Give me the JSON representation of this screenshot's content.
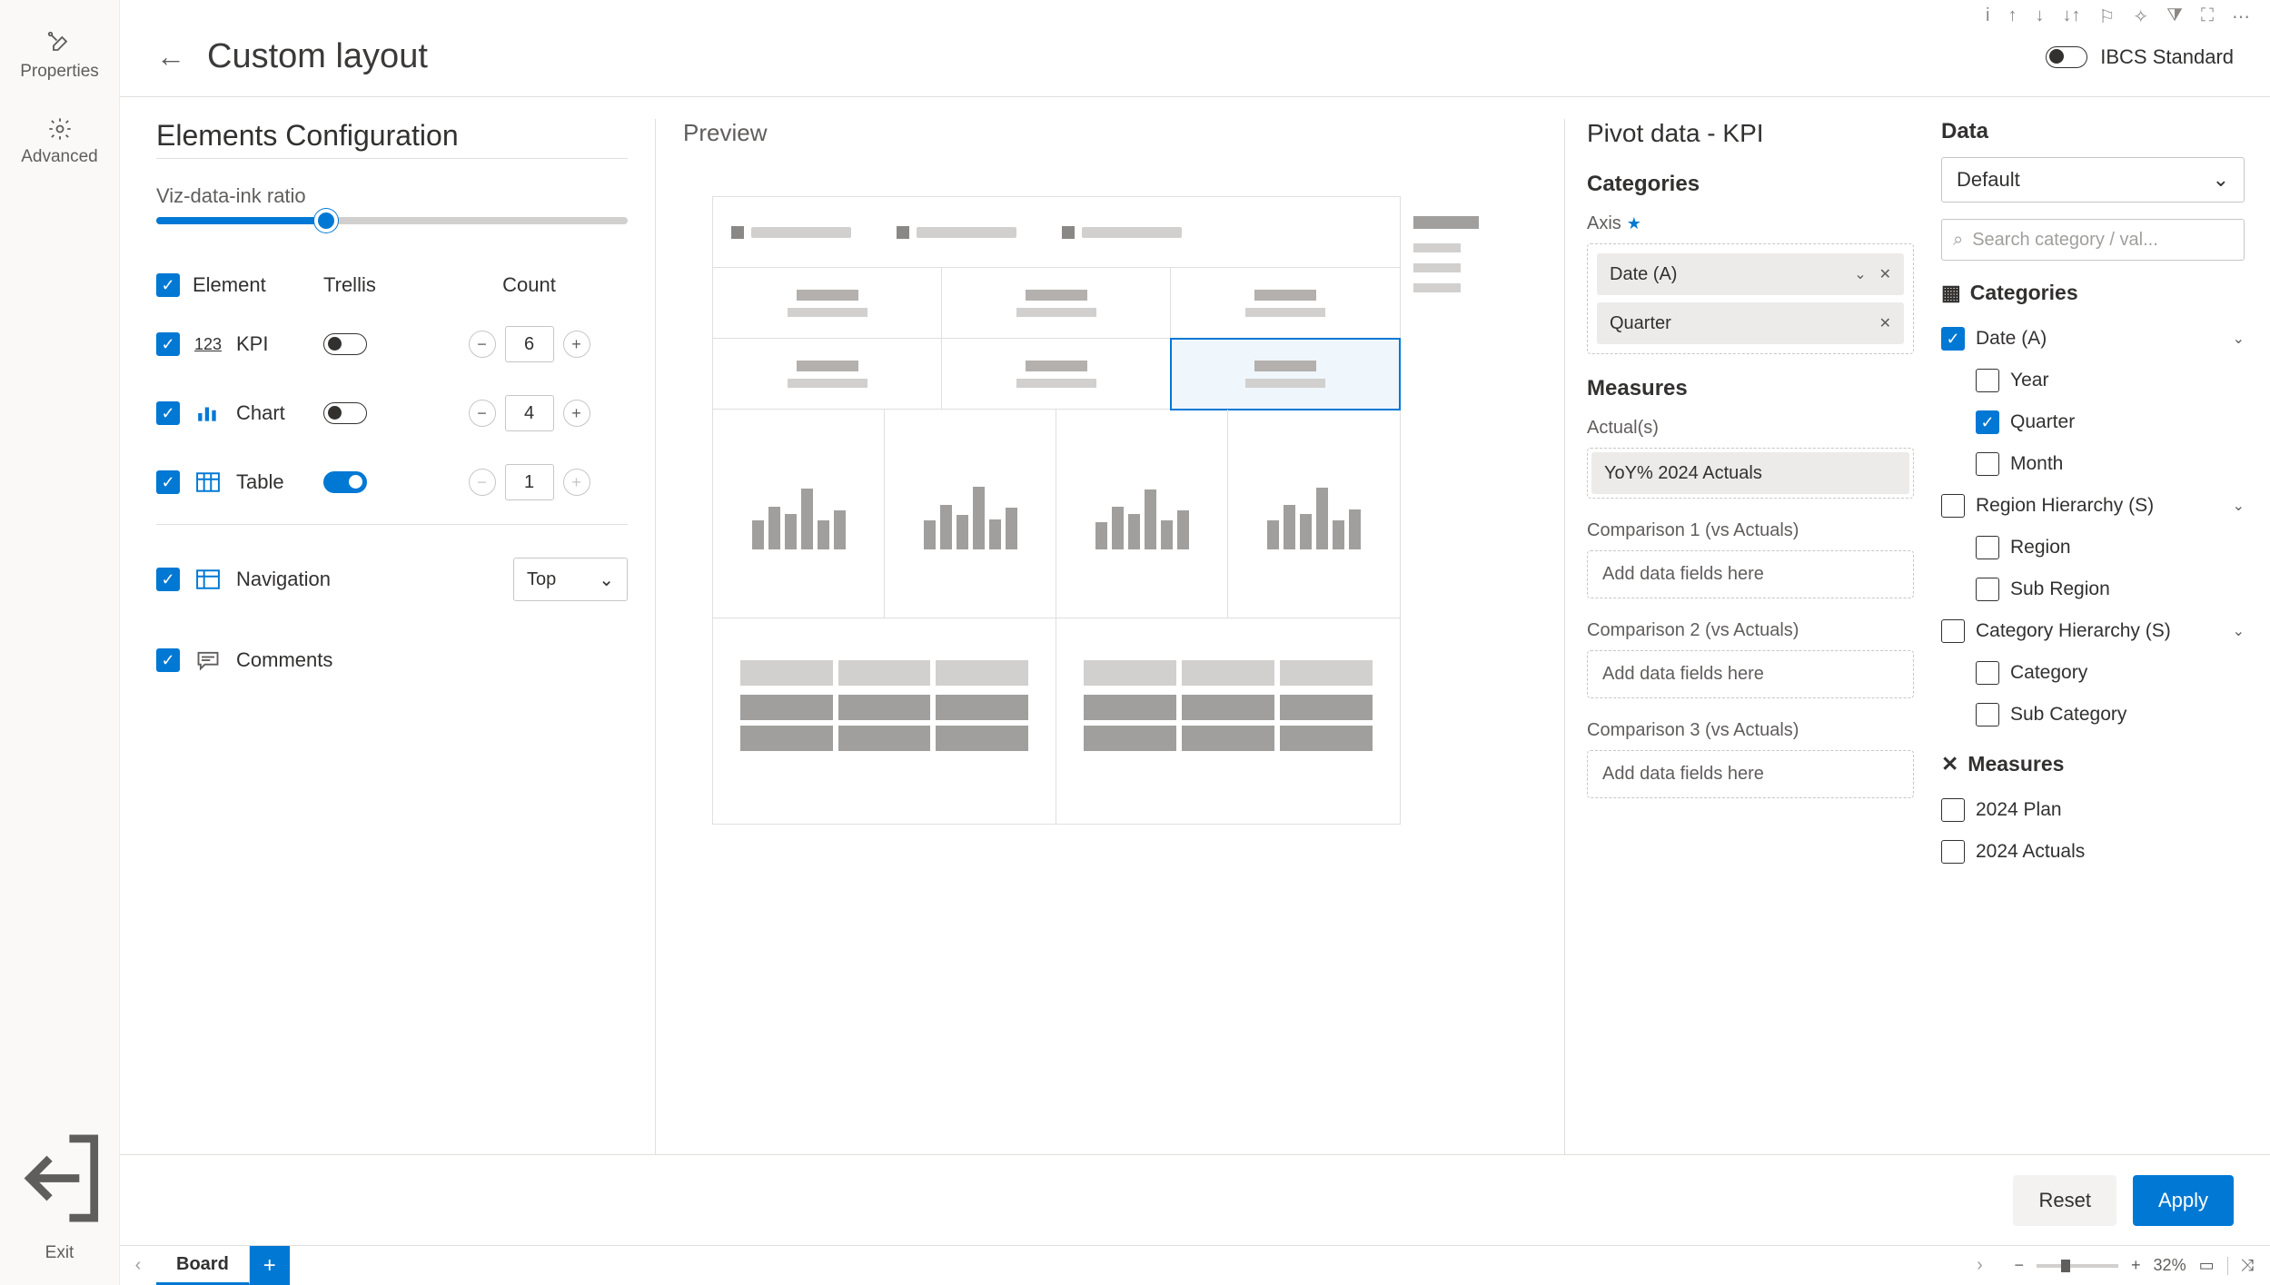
{
  "rail": {
    "properties": "Properties",
    "advanced": "Advanced",
    "exit": "Exit"
  },
  "toolbar": {
    "ibcs": "IBCS Standard"
  },
  "title": "Custom layout",
  "config": {
    "heading": "Elements Configuration",
    "slider_label": "Viz-data-ink ratio",
    "headers": {
      "element": "Element",
      "trellis": "Trellis",
      "count": "Count"
    },
    "rows": [
      {
        "label": "KPI",
        "count": "6",
        "trellis": false
      },
      {
        "label": "Chart",
        "count": "4",
        "trellis": false
      },
      {
        "label": "Table",
        "count": "1",
        "trellis": true
      }
    ],
    "navigation": {
      "label": "Navigation",
      "value": "Top"
    },
    "comments": "Comments"
  },
  "preview": {
    "heading": "Preview"
  },
  "pivot": {
    "heading": "Pivot data - KPI",
    "categories": "Categories",
    "axis_label": "Axis",
    "axis_chips": [
      "Date (A)",
      "Quarter"
    ],
    "measures": "Measures",
    "actuals_label": "Actual(s)",
    "actuals_chip": "YoY% 2024 Actuals",
    "comp1": "Comparison 1 (vs Actuals)",
    "comp2": "Comparison 2 (vs Actuals)",
    "comp3": "Comparison 3 (vs Actuals)",
    "placeholder": "Add data fields here"
  },
  "data": {
    "heading": "Data",
    "select": "Default",
    "search": "Search category / val...",
    "cat_head": "Categories",
    "meas_head": "Measures",
    "tree": {
      "date": "Date (A)",
      "year": "Year",
      "quarter": "Quarter",
      "month": "Month",
      "region_h": "Region Hierarchy (S)",
      "region": "Region",
      "subregion": "Sub Region",
      "cat_h": "Category Hierarchy (S)",
      "category": "Category",
      "subcategory": "Sub Category",
      "plan": "2024 Plan",
      "actuals": "2024 Actuals"
    }
  },
  "footer": {
    "reset": "Reset",
    "apply": "Apply"
  },
  "tabbar": {
    "board": "Board",
    "zoom": "32%"
  }
}
